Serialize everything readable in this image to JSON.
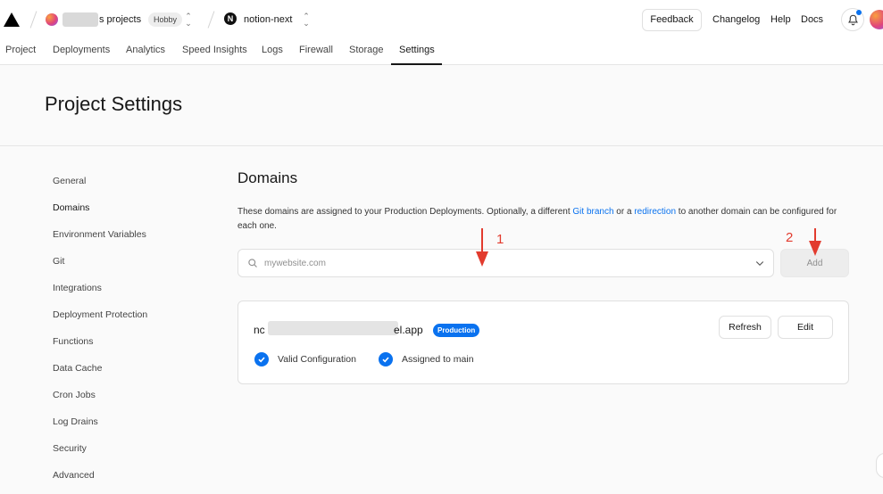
{
  "header": {
    "team_suffix": "s projects",
    "plan_badge": "Hobby",
    "project_name": "notion-next",
    "feedback_label": "Feedback",
    "changelog_label": "Changelog",
    "help_label": "Help",
    "docs_label": "Docs"
  },
  "tabs": [
    "Project",
    "Deployments",
    "Analytics",
    "Speed Insights",
    "Logs",
    "Firewall",
    "Storage",
    "Settings"
  ],
  "active_tab": "Settings",
  "page_title": "Project Settings",
  "sidebar": {
    "items": [
      "General",
      "Domains",
      "Environment Variables",
      "Git",
      "Integrations",
      "Deployment Protection",
      "Functions",
      "Data Cache",
      "Cron Jobs",
      "Log Drains",
      "Security",
      "Advanced"
    ],
    "active": "Domains"
  },
  "domains": {
    "title": "Domains",
    "description_part1": "These domains are assigned to your Production Deployments. Optionally, a different ",
    "link_git_branch": "Git branch",
    "description_part2": " or a ",
    "link_redirection": "redirection",
    "description_part3": " to another domain can be configured for each one.",
    "search_placeholder": "mywebsite.com",
    "add_label": "Add",
    "annotation_1": "1",
    "annotation_2": "2",
    "card": {
      "domain_prefix": "nc",
      "domain_suffix": "el.app",
      "badge": "Production",
      "refresh_label": "Refresh",
      "edit_label": "Edit",
      "status_1": "Valid Configuration",
      "status_2": "Assigned to main"
    }
  },
  "colors": {
    "accent": "#0a72ef",
    "annotation": "#e23b2e"
  }
}
